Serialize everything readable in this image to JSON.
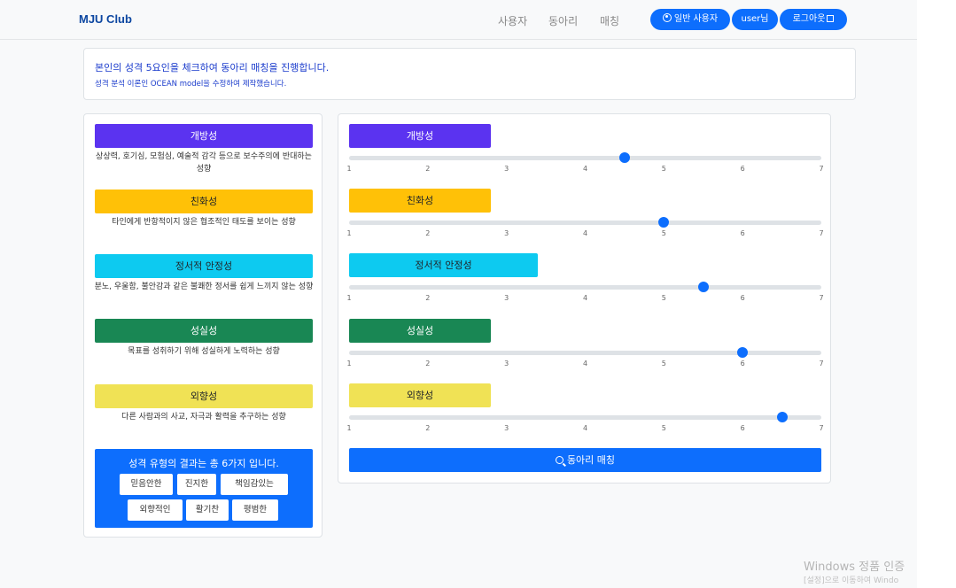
{
  "navbar": {
    "brand": "MJU Club",
    "links": [
      "사용자",
      "동아리",
      "매칭"
    ],
    "user_type_button": "일반 사용자",
    "user_button": "user님",
    "logout_button": "로그아웃"
  },
  "intro": {
    "line1": "본인의 성격 5요인을 체크하여 동아리 매칭을 진행합니다.",
    "line2": "성격 분석 이론인 OCEAN model을 수정하여 제작했습니다."
  },
  "traits": [
    {
      "name": "개방성",
      "desc": "상상력, 호기심, 모험심, 예술적 감각 등으로 보수주의에 반대하는 성향",
      "color": "#5b33f0",
      "text_color": "#ffffff",
      "value": 4.5
    },
    {
      "name": "친화성",
      "desc": "타인에게 반항적이지 않은 협조적인 태도를 보이는 성향",
      "color": "#ffc107",
      "text_color": "#212529",
      "value": 5.0
    },
    {
      "name": "정서적 안정성",
      "desc": "분노, 우울함, 불안감과 같은 불쾌한 정서를 쉽게 느끼지 않는 성향",
      "color": "#0dcaf0",
      "text_color": "#212529",
      "value": 5.5
    },
    {
      "name": "성실성",
      "desc": "목표를 성취하기 위해 성실하게 노력하는 성향",
      "color": "#198754",
      "text_color": "#ffffff",
      "value": 6.0
    },
    {
      "name": "외향성",
      "desc": "다른 사람과의 사교, 자극과 활력을 추구하는 성향",
      "color": "#f0e255",
      "text_color": "#212529",
      "value": 6.5
    }
  ],
  "scale": {
    "min": 1,
    "max": 7,
    "ticks": [
      "1",
      "2",
      "3",
      "4",
      "5",
      "6",
      "7"
    ]
  },
  "result": {
    "title": "성격 유형의 결과는 총 6가지 입니다.",
    "chips": [
      "믿음안한",
      "진지한",
      "책임감있는",
      "외향적인",
      "활기찬",
      "평범한"
    ]
  },
  "match_button": "동아리 매칭",
  "watermark": {
    "line1": "Windows 정품 인증",
    "line2": "[설정]으로 이동하여 Windo"
  }
}
